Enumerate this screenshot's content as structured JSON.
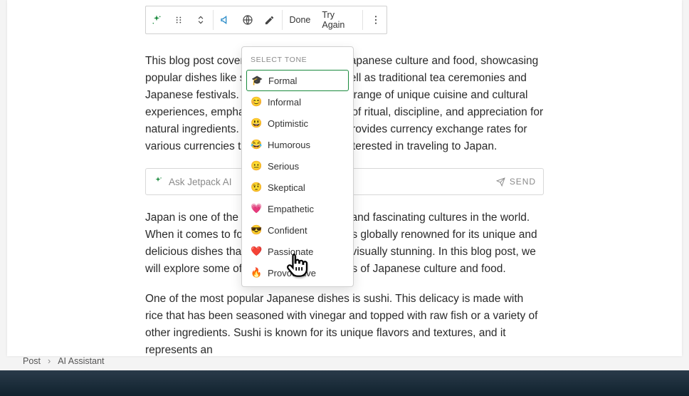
{
  "toolbar": {
    "done_label": "Done",
    "try_again_label": "Try Again"
  },
  "dropdown": {
    "header": "SELECT TONE",
    "items": [
      {
        "emoji": "🎓",
        "label": "Formal",
        "highlight": true
      },
      {
        "emoji": "😊",
        "label": "Informal",
        "highlight": false
      },
      {
        "emoji": "😃",
        "label": "Optimistic",
        "highlight": false
      },
      {
        "emoji": "😂",
        "label": "Humorous",
        "highlight": false
      },
      {
        "emoji": "😐",
        "label": "Serious",
        "highlight": false
      },
      {
        "emoji": "🤨",
        "label": "Skeptical",
        "highlight": false
      },
      {
        "emoji": "💗",
        "label": "Empathetic",
        "highlight": false
      },
      {
        "emoji": "😎",
        "label": "Confident",
        "highlight": false
      },
      {
        "emoji": "❤️",
        "label": "Passionate",
        "highlight": false
      },
      {
        "emoji": "🔥",
        "label": "Provocative",
        "highlight": false
      }
    ]
  },
  "paragraphs": {
    "p1": "This blog post covers various aspects of Japanese culture and food, showcasing popular dishes like sushi and ramen, as well as traditional tea ceremonies and Japanese festivals. Japan offers a diverse range of unique cuisine and cultural experiences, emphasizing the importance of ritual, discipline, and appreciation for natural ingredients. Additionally, the blog provides currency exchange rates for various currencies to JPY for individuals interested in traveling to Japan.",
    "p2": "Japan is one of the most culturally vibrant and fascinating cultures in the world. When it comes to food, Japanese cuisine is globally renowned for its unique and delicious dishes that are both healthy and visually stunning. In this blog post, we will explore some of the fascinating aspects of Japanese culture and food.",
    "p3": "One of the most popular Japanese dishes is sushi. This delicacy is made with rice that has been seasoned with vinegar and topped with raw fish or a variety of other ingredients. Sushi is known for its unique flavors and textures, and it represents an"
  },
  "askbar": {
    "placeholder": "Ask Jetpack AI",
    "send_label": "SEND"
  },
  "breadcrumbs": {
    "root": "Post",
    "current": "AI Assistant"
  }
}
